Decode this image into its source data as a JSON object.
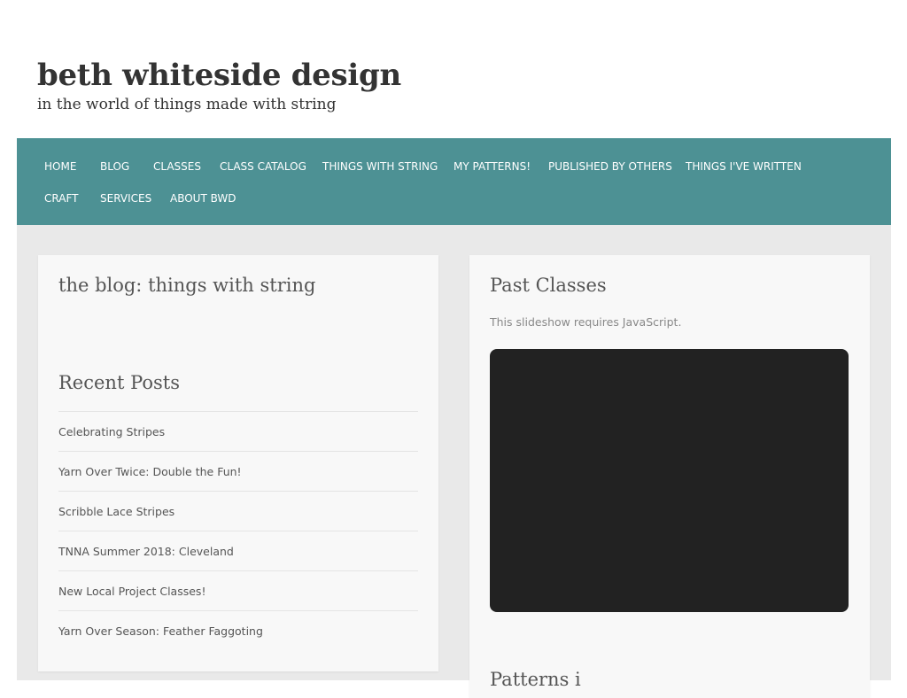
{
  "site": {
    "title": "beth whiteside design",
    "tagline": "in the world of things made with string"
  },
  "nav": {
    "items": [
      "HOME",
      "BLOG",
      "CLASSES",
      "CLASS CATALOG",
      "THINGS WITH STRING",
      "MY PATTERNS!",
      "PUBLISHED BY OTHERS",
      "THINGS I'VE WRITTEN",
      "CRAFT",
      "SERVICES",
      "ABOUT BWD"
    ]
  },
  "left_panel": {
    "blog_title": "the blog: things with string",
    "recent_title": "Recent Posts",
    "posts": [
      "Celebrating Stripes",
      "Yarn Over Twice: Double the Fun!",
      "Scribble Lace Stripes",
      "TNNA Summer 2018: Cleveland",
      "New Local Project Classes!",
      "Yarn Over Season: Feather Faggoting"
    ]
  },
  "right_panel": {
    "title": "Past Classes",
    "js_note": "This slideshow requires JavaScript.",
    "next_title": "Patterns i"
  }
}
